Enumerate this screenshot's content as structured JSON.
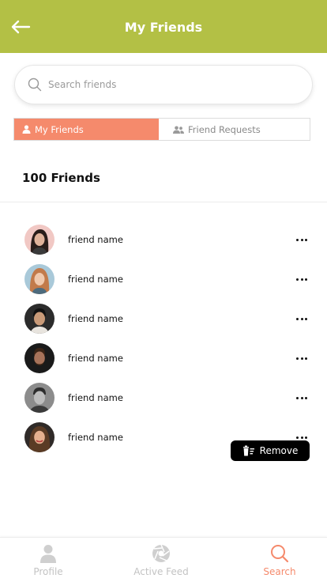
{
  "header": {
    "title": "My Friends"
  },
  "search": {
    "placeholder": "Search friends"
  },
  "tabs": [
    {
      "label": "My Friends",
      "active": true
    },
    {
      "label": "Friend Requests",
      "active": false
    }
  ],
  "friends_count": "100 Friends",
  "friends": [
    {
      "name": "friend name"
    },
    {
      "name": "friend name"
    },
    {
      "name": "friend name"
    },
    {
      "name": "friend name"
    },
    {
      "name": "friend name"
    },
    {
      "name": "friend name"
    }
  ],
  "remove_popup": {
    "label": "Remove"
  },
  "bottom_nav": [
    {
      "label": "Profile",
      "icon": "person-icon",
      "active": false
    },
    {
      "label": "Active Feed",
      "icon": "aperture-icon",
      "active": false
    },
    {
      "label": "Search",
      "icon": "search-icon",
      "active": true
    }
  ],
  "colors": {
    "header_bg": "#b3c045",
    "accent": "#f58a6c"
  }
}
